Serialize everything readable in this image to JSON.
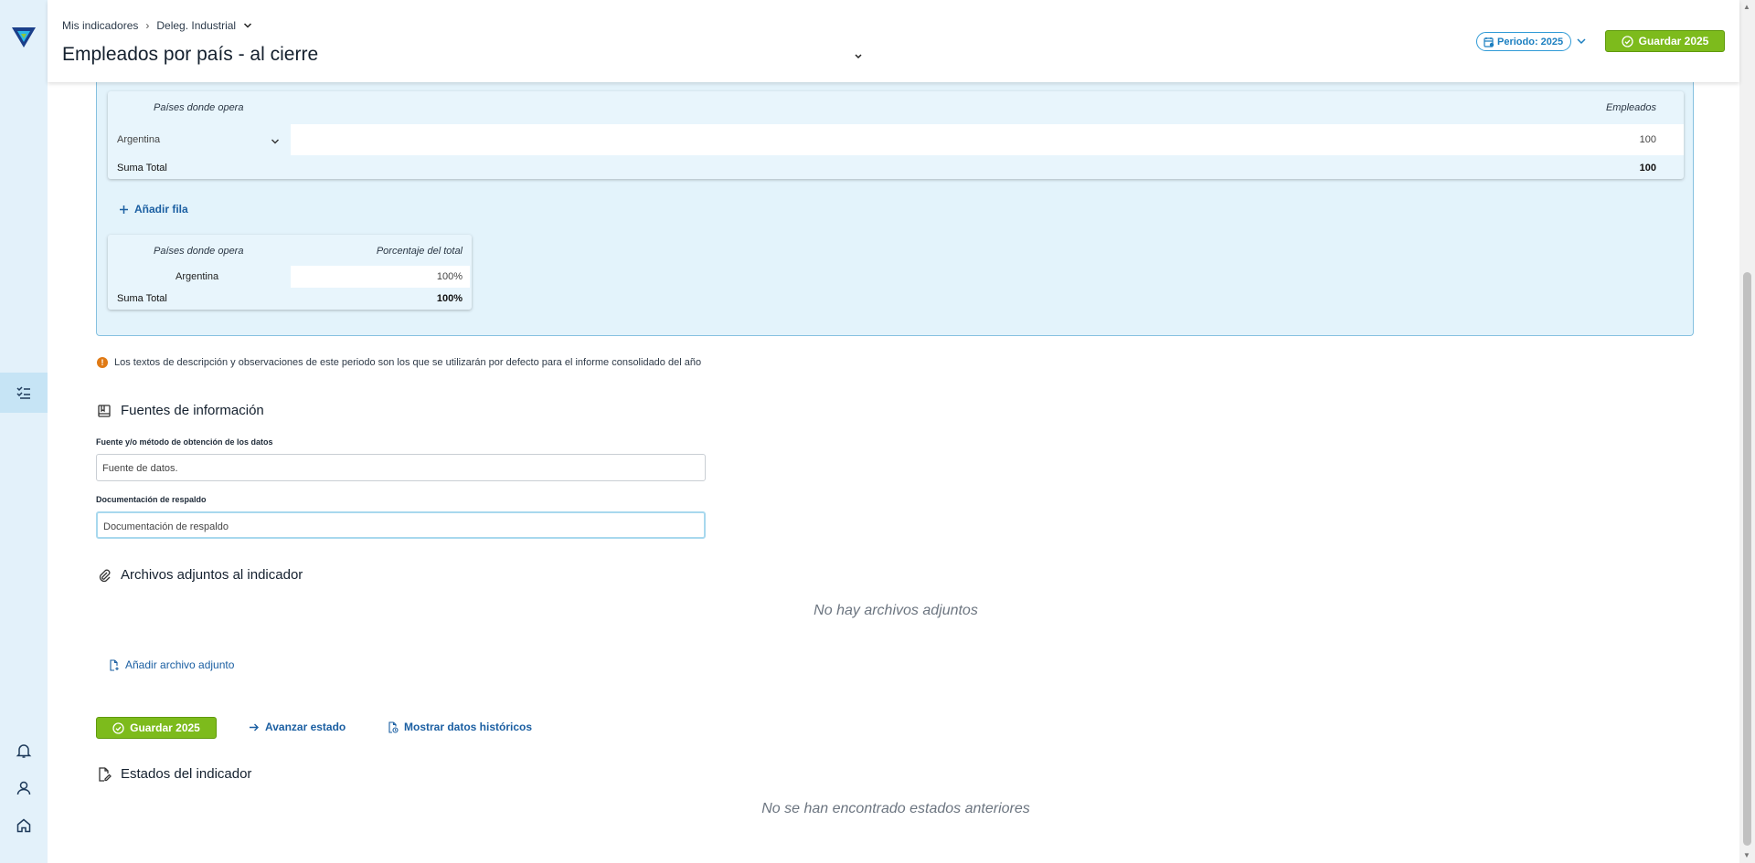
{
  "breadcrumb": {
    "root": "Mis indicadores",
    "current": "Deleg. Industrial"
  },
  "header": {
    "title": "Empleados por país - al cierre",
    "period_label": "Periodo: 2025",
    "save_label": "Guardar 2025"
  },
  "employees_table": {
    "col_country": "Países donde opera",
    "col_employees": "Empleados",
    "rows": [
      {
        "country": "Argentina",
        "employees": "100"
      }
    ],
    "total_label": "Suma Total",
    "total_value": "100"
  },
  "add_row_label": "Añadir fila",
  "percent_table": {
    "col_country": "Países donde opera",
    "col_percent": "Porcentaje del total",
    "rows": [
      {
        "country": "Argentina",
        "percent": "100%"
      }
    ],
    "total_label": "Suma Total",
    "total_value": "100%"
  },
  "notice": "Los textos de descripción y observaciones de este periodo son los que se utilizarán por defecto para el informe consolidado del año",
  "sources": {
    "title": "Fuentes de información",
    "source_label": "Fuente y/o método de obtención de los datos",
    "source_value": "Fuente de datos.",
    "doc_label": "Documentación de respaldo",
    "doc_value": "Documentación de respaldo"
  },
  "attachments": {
    "title": "Archivos adjuntos al indicador",
    "empty": "No hay archivos adjuntos",
    "add_label": "Añadir archivo adjunto"
  },
  "actions": {
    "save_label": "Guardar 2025",
    "advance_label": "Avanzar estado",
    "history_label": "Mostrar datos históricos"
  },
  "states": {
    "title": "Estados del indicador",
    "empty": "No se han encontrado estados anteriores"
  },
  "colors": {
    "brand_blue": "#1b5fa2",
    "save_green": "#7dbb1c",
    "panel_bg": "#e3f3fb",
    "warning": "#e07a15"
  },
  "icons": [
    "logo-icon",
    "checklist-icon",
    "bell-icon",
    "user-icon",
    "home-icon",
    "calendar-icon",
    "check-circle-icon",
    "chevron-down-icon",
    "plus-icon",
    "warning-icon",
    "book-icon",
    "paperclip-icon",
    "file-add-icon",
    "arrow-right-icon",
    "file-history-icon",
    "file-edit-icon"
  ]
}
